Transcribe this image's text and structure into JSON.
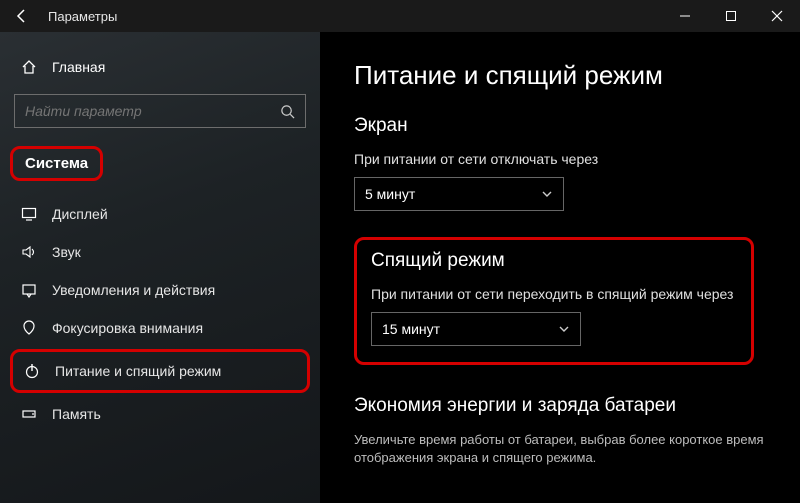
{
  "titlebar": {
    "title": "Параметры"
  },
  "sidebar": {
    "home": "Главная",
    "search_placeholder": "Найти параметр",
    "section": "Система",
    "items": [
      {
        "icon": "display-icon",
        "label": "Дисплей"
      },
      {
        "icon": "sound-icon",
        "label": "Звук"
      },
      {
        "icon": "notifications-icon",
        "label": "Уведомления и действия"
      },
      {
        "icon": "focus-icon",
        "label": "Фокусировка внимания"
      },
      {
        "icon": "power-icon",
        "label": "Питание и спящий режим"
      },
      {
        "icon": "storage-icon",
        "label": "Память"
      }
    ]
  },
  "main": {
    "title": "Питание и спящий режим",
    "screen": {
      "heading": "Экран",
      "label": "При питании от сети отключать через",
      "value": "5 минут"
    },
    "sleep": {
      "heading": "Спящий режим",
      "label": "При питании от сети переходить в спящий режим через",
      "value": "15 минут"
    },
    "battery": {
      "heading": "Экономия энергии и заряда батареи",
      "text": "Увеличьте время работы от батареи, выбрав более короткое время отображения экрана и спящего режима."
    }
  }
}
